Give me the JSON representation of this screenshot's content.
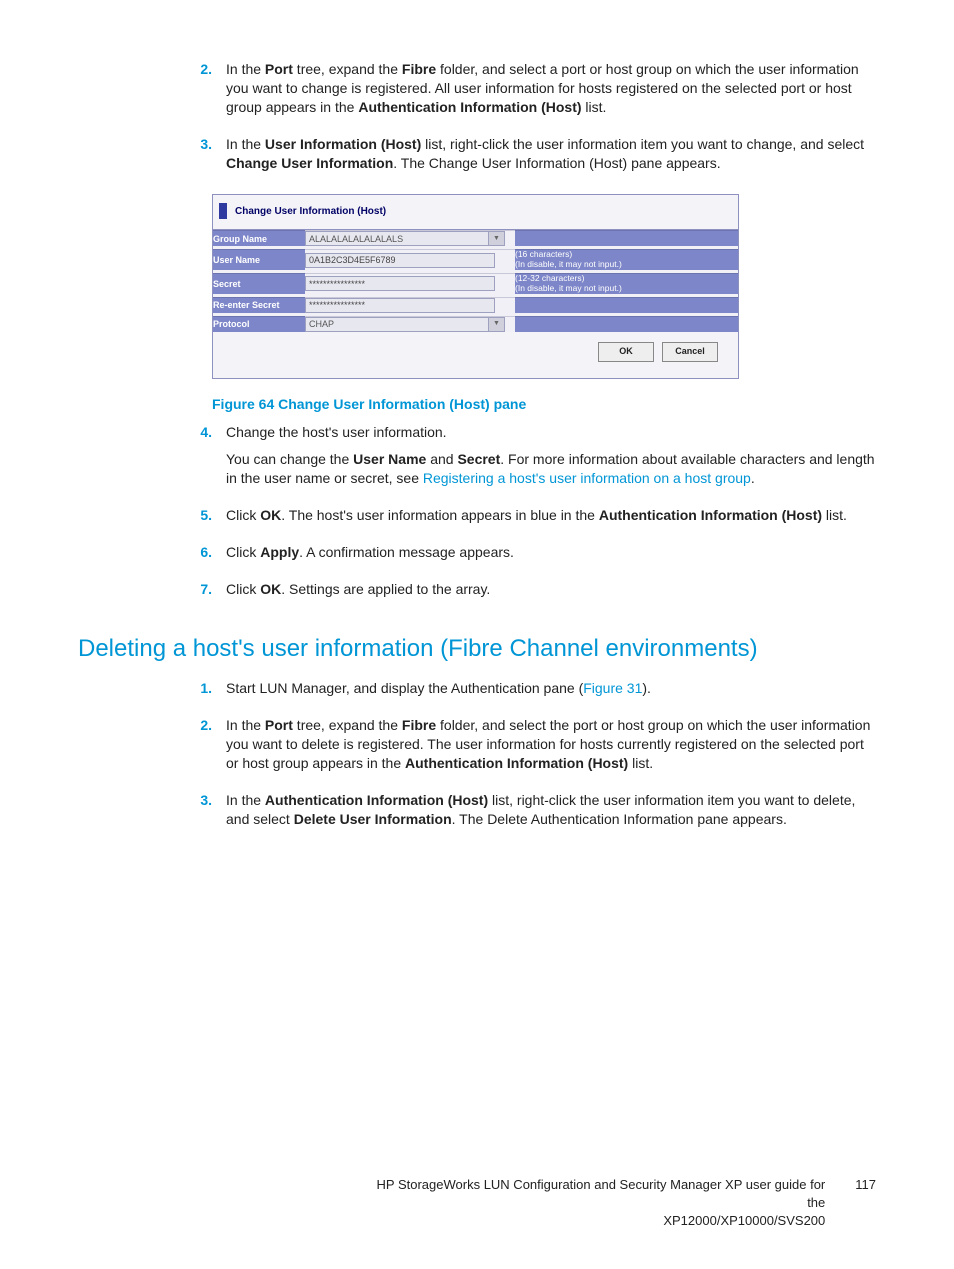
{
  "steps_a": {
    "s2": {
      "num": "2.",
      "text_pre": "In the ",
      "port": "Port",
      "mid1": " tree, expand the ",
      "fibre": "Fibre",
      "mid2": " folder, and select a port or host group on which the user information you want to change is registered. All user information for hosts registered on the selected port or host group appears in the ",
      "auth": "Authentication Information (Host)",
      "end": " list."
    },
    "s3": {
      "num": "3.",
      "text_pre": "In the ",
      "uih": "User Information (Host)",
      "mid1": " list, right-click the user information item you want to change, and select ",
      "cui": "Change User Information",
      "end": ". The Change User Information (Host) pane appears."
    },
    "s4": {
      "num": "4.",
      "line1": "Change the host's user information.",
      "line2a": "You can change the ",
      "user": "User Name",
      "and": " and ",
      "secret": "Secret",
      "line2b": ". For more information about available characters and length in the user name or secret, see ",
      "link": "Registering a host's user information on a host group",
      "end": "."
    },
    "s5": {
      "num": "5.",
      "pre": "Click ",
      "ok": "OK",
      "mid": ". The host's user information appears in blue in the ",
      "auth": "Authentication Information (Host)",
      "end": " list."
    },
    "s6": {
      "num": "6.",
      "pre": "Click ",
      "apply": "Apply",
      "end": ". A confirmation message appears."
    },
    "s7": {
      "num": "7.",
      "pre": "Click ",
      "ok": "OK",
      "end": ". Settings are applied to the array."
    }
  },
  "pane": {
    "title": "Change User Information (Host)",
    "labels": {
      "group": "Group Name",
      "user": "User Name",
      "secret": "Secret",
      "reenter": "Re-enter Secret",
      "protocol": "Protocol"
    },
    "values": {
      "group": "ALALALALALALALALS",
      "user": "0A1B2C3D4E5F6789",
      "secret": "****************",
      "reenter": "****************",
      "protocol": "CHAP"
    },
    "help": {
      "user_l1": "(16 characters)",
      "user_l2": "(In disable, it may not input.)",
      "secret_l1": "(12-32 characters)",
      "secret_l2": "(In disable, it may not input.)"
    },
    "buttons": {
      "ok": "OK",
      "cancel": "Cancel"
    }
  },
  "figure_caption": "Figure 64 Change User Information (Host) pane",
  "section_heading": "Deleting a host's user information (Fibre Channel environments)",
  "steps_b": {
    "s1": {
      "num": "1.",
      "pre": "Start LUN Manager, and display the Authentication pane (",
      "link": "Figure 31",
      "end": ")."
    },
    "s2": {
      "num": "2.",
      "pre": "In the ",
      "port": "Port",
      "mid1": " tree, expand the ",
      "fibre": "Fibre",
      "mid2": " folder, and select the port or host group on which the user information you want to delete is registered. The user information for hosts currently registered on the selected port or host group appears in the ",
      "auth": "Authentication Information (Host)",
      "end": " list."
    },
    "s3": {
      "num": "3.",
      "pre": "In the ",
      "auth": "Authentication Information (Host)",
      "mid": " list, right-click the user information item you want to delete, and select ",
      "dui": "Delete User Information",
      "end": ". The Delete Authentication Information pane appears."
    }
  },
  "footer": {
    "text1": "HP StorageWorks LUN Configuration and Security Manager XP user guide for the",
    "text2": "XP12000/XP10000/SVS200",
    "page": "117"
  }
}
